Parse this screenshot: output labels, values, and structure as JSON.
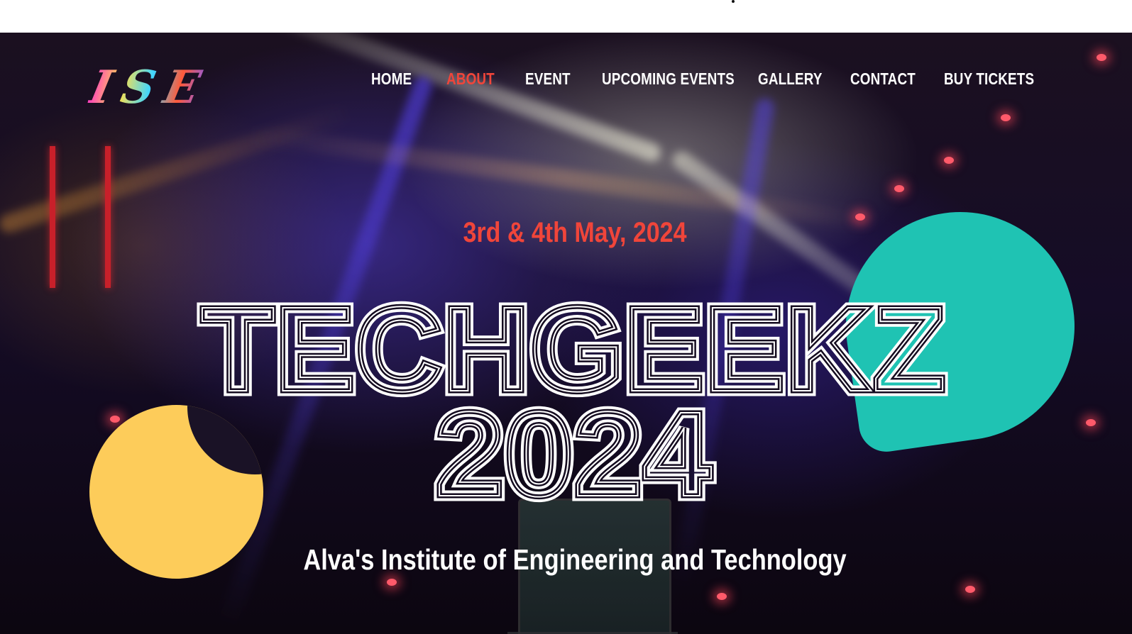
{
  "logo": {
    "text": "ISE"
  },
  "nav": {
    "items": [
      {
        "label": "HOME",
        "active": false
      },
      {
        "label": "ABOUT",
        "active": true
      },
      {
        "label": "EVENT",
        "active": false
      },
      {
        "label": "UPCOMING EVENTS",
        "active": false
      },
      {
        "label": "GALLERY",
        "active": false
      },
      {
        "label": "CONTACT",
        "active": false
      },
      {
        "label": "BUY TICKETS",
        "active": false
      }
    ]
  },
  "hero": {
    "date": "3rd & 4th May, 2024",
    "title_line1": "TECHGEEKZ",
    "title_line2": "2024",
    "subtitle": "Alva's Institute of Engineering and Technology"
  },
  "colors": {
    "accent_red": "#f0453a",
    "teal_blob": "#1fc3b3",
    "yellow_blob": "#fdcc5a",
    "nav_text": "#ffffff"
  }
}
